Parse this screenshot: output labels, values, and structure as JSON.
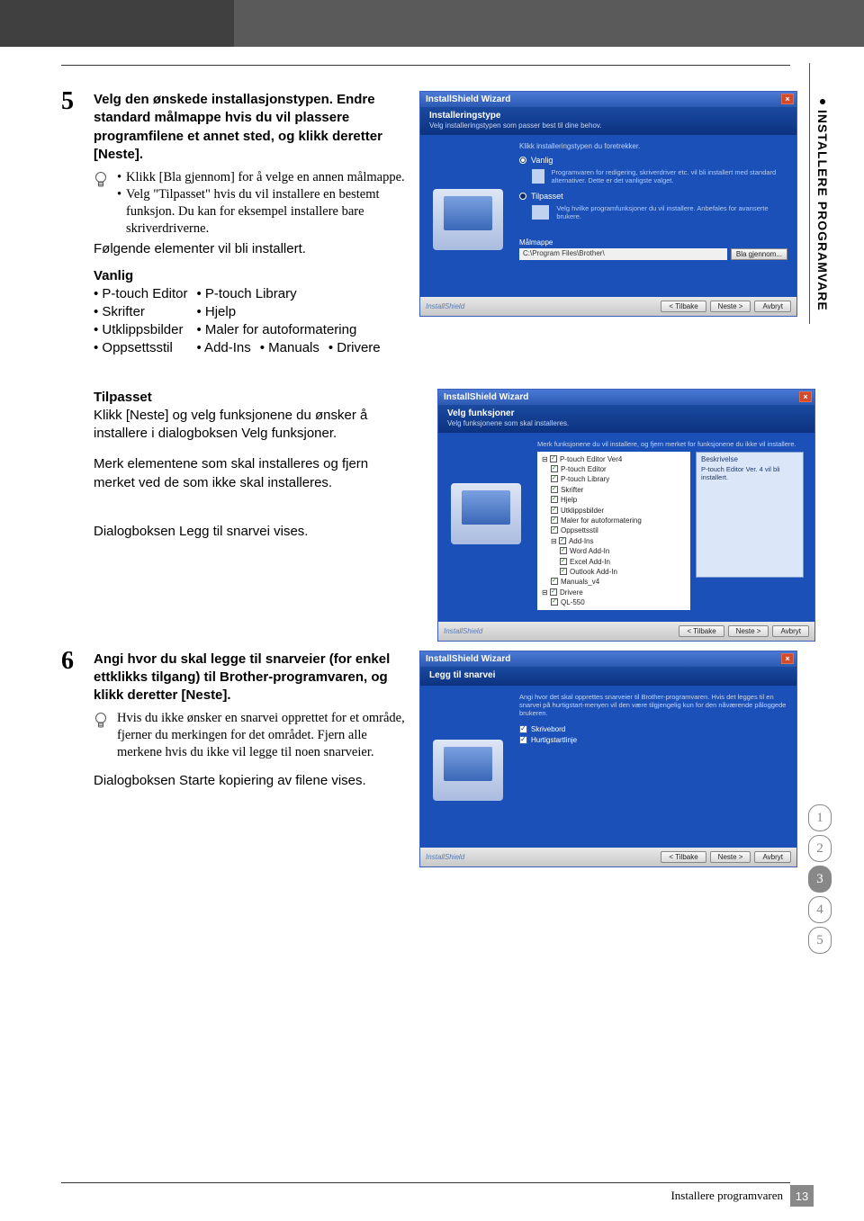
{
  "sideTab": "INSTALLERE PROGRAMVARE",
  "step5": {
    "num": "5",
    "lead": "Velg den ønskede installasjonstypen. Endre standard målmappe hvis du vil plassere programfilene et annet sted, og klikk deretter [Neste].",
    "tip1": "Klikk [Bla gjennom] for å velge en annen målmappe.",
    "tip2": "Velg \"Tilpasset\" hvis du vil installere en bestemt funksjon. Du kan for eksempel installere bare skriverdriverne.",
    "following": "Følgende elementer vil bli installert.",
    "vanligHeader": "Vanlig",
    "vanlig": {
      "c1r1": "• P-touch Editor",
      "c2r1": "• P-touch Library",
      "c1r2": "• Skrifter",
      "c2r2": "• Hjelp",
      "c1r3": "• Utklippsbilder",
      "c2r3": "• Maler for autoformatering",
      "c1r4": "• Oppsettsstil",
      "c2r4a": "• Add-Ins",
      "c2r4b": "• Manuals",
      "c2r4c": "• Drivere"
    },
    "tilpassetHeader": "Tilpasset",
    "tilpassetP1": "Klikk [Neste] og velg funksjonene du ønsker å installere i dialogboksen Velg funksjoner.",
    "tilpassetP2": "Merk elementene som skal installeres og fjern merket ved de som ikke skal installeres.",
    "dialog1": "Dialogboksen Legg til snarvei vises."
  },
  "step6": {
    "num": "6",
    "lead": "Angi hvor du skal legge til snarveier (for enkel ettklikks tilgang) til Brother-programvaren, og klikk deretter [Neste].",
    "tip": "Hvis du ikke ønsker en snarvei opprettet for et område, fjerner du merkingen for det området. Fjern alle merkene hvis du ikke vil legge til noen snarveier.",
    "dialog": "Dialogboksen Starte kopiering av filene vises."
  },
  "wizard1": {
    "title": "InstallShield Wizard",
    "hdrT": "Installeringstype",
    "hdrS": "Velg installeringstypen som passer best til dine behov.",
    "line": "Klikk installeringstypen du foretrekker.",
    "opt1": "Vanlig",
    "opt1s": "Programvaren for redigering, skriverdriver etc. vil bli installert med standard alternativer. Dette er det vanligste valget.",
    "opt2": "Tilpasset",
    "opt2s": "Velg hvilke programfunksjoner du vil installere. Anbefales for avanserte brukere.",
    "destLbl": "Målmappe",
    "path": "C:\\Program Files\\Brother\\",
    "browse": "Bla gjennom...",
    "back": "< Tilbake",
    "next": "Neste >",
    "cancel": "Avbryt",
    "brand": "InstallShield"
  },
  "wizard2": {
    "title": "InstallShield Wizard",
    "hdrT": "Velg funksjoner",
    "hdrS": "Velg funksjonene som skal installeres.",
    "line": "Merk funksjonene du vil installere, og fjern merket for funksjonene du ikke vil installere.",
    "items": [
      "P-touch Editor Ver4",
      "P-touch Editor",
      "P-touch Library",
      "Skrifter",
      "Hjelp",
      "Utklippsbilder",
      "Maler for autoformatering",
      "Oppsettsstil",
      "Add-Ins",
      "Word Add-In",
      "Excel Add-In",
      "Outlook Add-In",
      "Manuals_v4",
      "Drivere",
      "QL-550"
    ],
    "descH": "Beskrivelse",
    "descT": "P-touch Editor Ver. 4 vil bli installert.",
    "back": "< Tilbake",
    "next": "Neste >",
    "cancel": "Avbryt",
    "brand": "InstallShield"
  },
  "wizard3": {
    "title": "InstallShield Wizard",
    "hdrT": "Legg til snarvei",
    "info": "Angi hvor det skal opprettes snarveier til Brother-programvaren. Hvis det legges til en snarvei på hurtigstart-menyen vil den være tilgjengelig kun for den nåværende påloggede brukeren.",
    "chk1": "Skrivebord",
    "chk2": "Hurtigstartlinje",
    "back": "< Tilbake",
    "next": "Neste >",
    "cancel": "Avbryt",
    "brand": "InstallShield"
  },
  "nav": [
    "1",
    "2",
    "3",
    "4",
    "5"
  ],
  "footerText": "Installere programvaren",
  "pageNum": "13"
}
